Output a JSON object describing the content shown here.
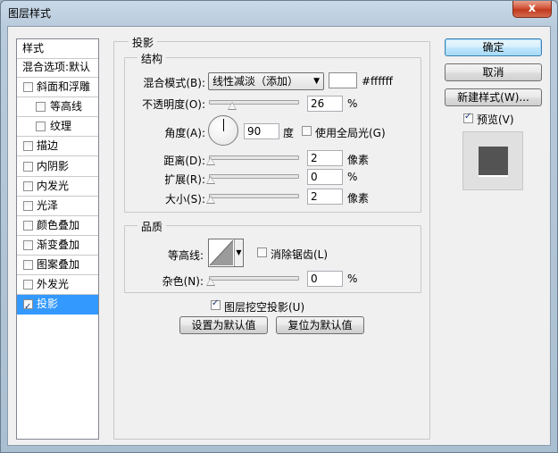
{
  "window": {
    "title": "图层样式",
    "close_label": "x"
  },
  "style_list": {
    "header": "样式",
    "items": [
      {
        "label": "混合选项:默认",
        "checkbox": false,
        "checked": false,
        "indent": false,
        "selected": false
      },
      {
        "label": "斜面和浮雕",
        "checkbox": true,
        "checked": false,
        "indent": false,
        "selected": false
      },
      {
        "label": "等高线",
        "checkbox": true,
        "checked": false,
        "indent": true,
        "selected": false
      },
      {
        "label": "纹理",
        "checkbox": true,
        "checked": false,
        "indent": true,
        "selected": false
      },
      {
        "label": "描边",
        "checkbox": true,
        "checked": false,
        "indent": false,
        "selected": false
      },
      {
        "label": "内阴影",
        "checkbox": true,
        "checked": false,
        "indent": false,
        "selected": false
      },
      {
        "label": "内发光",
        "checkbox": true,
        "checked": false,
        "indent": false,
        "selected": false
      },
      {
        "label": "光泽",
        "checkbox": true,
        "checked": false,
        "indent": false,
        "selected": false
      },
      {
        "label": "颜色叠加",
        "checkbox": true,
        "checked": false,
        "indent": false,
        "selected": false
      },
      {
        "label": "渐变叠加",
        "checkbox": true,
        "checked": false,
        "indent": false,
        "selected": false
      },
      {
        "label": "图案叠加",
        "checkbox": true,
        "checked": false,
        "indent": false,
        "selected": false
      },
      {
        "label": "外发光",
        "checkbox": true,
        "checked": false,
        "indent": false,
        "selected": false
      },
      {
        "label": "投影",
        "checkbox": true,
        "checked": true,
        "indent": false,
        "selected": true
      }
    ]
  },
  "drop_shadow": {
    "group_title": "投影",
    "structure": {
      "title": "结构",
      "blend_mode_label": "混合模式(B):",
      "blend_mode_value": "线性减淡（添加）",
      "color_hex": "#ffffff",
      "opacity_label": "不透明度(O):",
      "opacity_value": "26",
      "opacity_fraction": 0.26,
      "percent": "%",
      "angle_label": "角度(A):",
      "angle_value": "90",
      "angle_unit": "度",
      "global_light_label": "使用全局光(G)",
      "global_light_checked": false,
      "distance_label": "距离(D):",
      "distance_value": "2",
      "distance_unit": "像素",
      "spread_label": "扩展(R):",
      "spread_value": "0",
      "size_label": "大小(S):",
      "size_value": "2",
      "size_unit": "像素"
    },
    "quality": {
      "title": "品质",
      "contour_label": "等高线:",
      "anti_alias_label": "消除锯齿(L)",
      "anti_alias_checked": false,
      "noise_label": "杂色(N):",
      "noise_value": "0",
      "percent": "%"
    },
    "knockout_label": "图层挖空投影(U)",
    "knockout_checked": true,
    "make_default_label": "设置为默认值",
    "reset_default_label": "复位为默认值"
  },
  "actions": {
    "ok_label": "确定",
    "cancel_label": "取消",
    "new_style_label": "新建样式(W)...",
    "preview_label": "预览(V)",
    "preview_checked": true
  },
  "colors": {
    "selection": "#3399ff",
    "shadow_color": "#ffffff",
    "preview_swatch": "#535353"
  }
}
